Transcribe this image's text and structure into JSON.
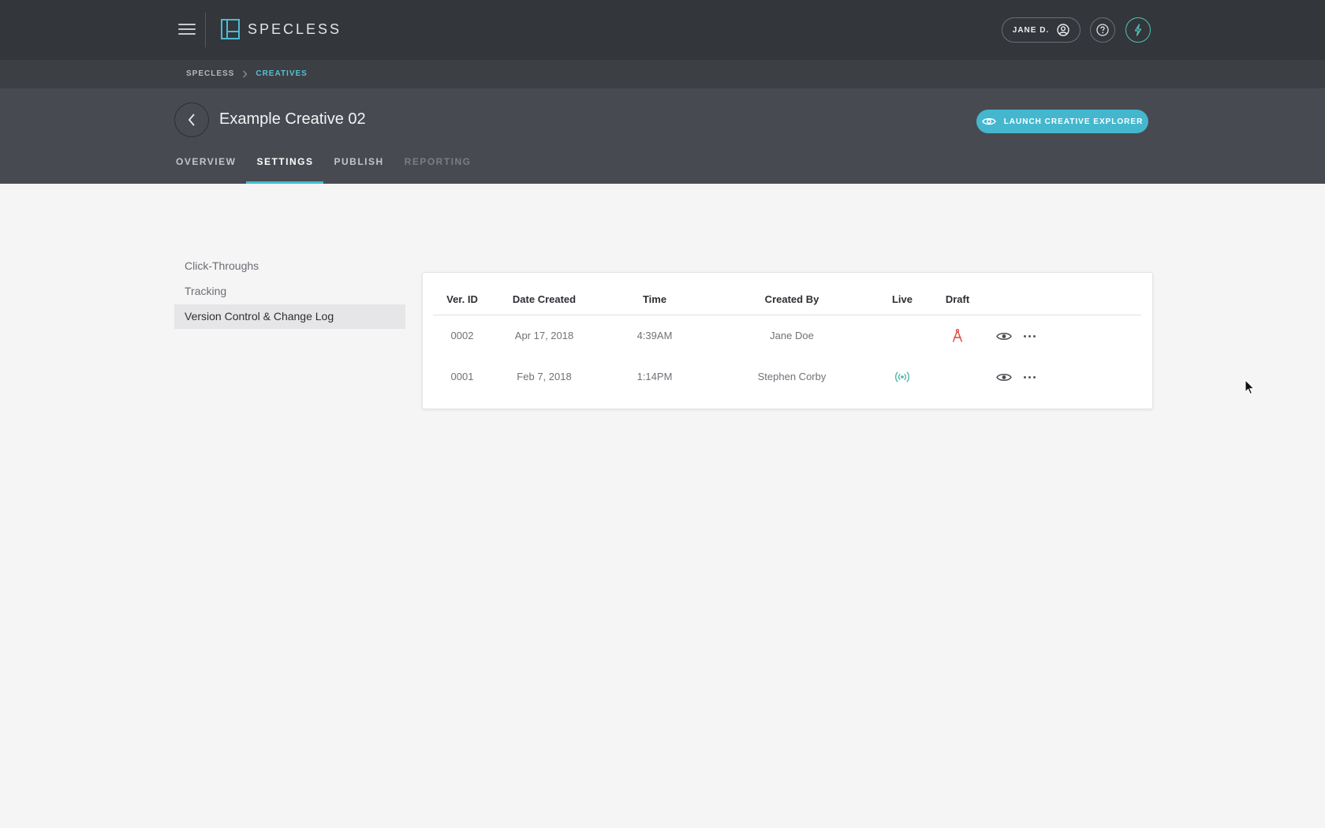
{
  "topbar": {
    "brand": "SPECLESS",
    "user_label": "JANE D."
  },
  "breadcrumb": {
    "root": "SPECLESS",
    "current": "CREATIVES"
  },
  "header": {
    "title": "Example Creative 02",
    "launch_label": "LAUNCH CREATIVE EXPLORER",
    "tabs": [
      {
        "label": "OVERVIEW"
      },
      {
        "label": "SETTINGS"
      },
      {
        "label": "PUBLISH"
      },
      {
        "label": "REPORTING"
      }
    ],
    "active_tab": "SETTINGS"
  },
  "sidenav": {
    "items": [
      {
        "label": "Click-Throughs"
      },
      {
        "label": "Tracking"
      },
      {
        "label": "Version Control & Change Log"
      }
    ],
    "active_item": "Version Control & Change Log"
  },
  "table": {
    "columns": [
      "Ver. ID",
      "Date Created",
      "Time",
      "Created By",
      "Live",
      "Draft"
    ],
    "rows": [
      {
        "ver_id": "0002",
        "date": "Apr 17, 2018",
        "time": "4:39AM",
        "created_by": "Jane Doe",
        "live": false,
        "draft": true
      },
      {
        "ver_id": "0001",
        "date": "Feb 7, 2018",
        "time": "1:14PM",
        "created_by": "Stephen Corby",
        "live": true,
        "draft": false
      }
    ]
  },
  "icons": {
    "menu": "hamburger-menu-icon",
    "user": "user-circle-icon",
    "help": "question-circle-icon",
    "bolt": "lightning-bolt-icon",
    "back": "chevron-left-icon",
    "launch": "eye-icon",
    "live": "broadcast-icon",
    "draft": "drafting-compass-icon",
    "view": "eye-icon",
    "more": "more-horizontal-icon"
  },
  "colors": {
    "accent": "#48bcd6",
    "live": "#4fb3a6",
    "draft": "#e0423a",
    "topbar": "#33363b",
    "subheader": "#474b51"
  }
}
